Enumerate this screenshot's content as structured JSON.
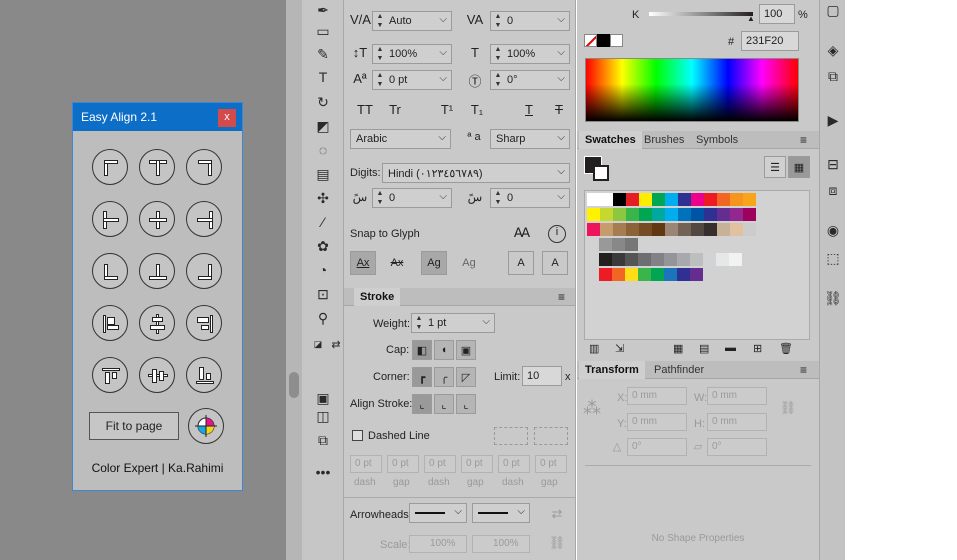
{
  "dialog": {
    "title": "Easy Align 2.1",
    "close_label": "x",
    "fit_label": "Fit to page",
    "credit": "Color Expert | Ka.Rahimi"
  },
  "character": {
    "kerning": "Auto",
    "tracking": "0",
    "vscale": "100%",
    "hscale": "100%",
    "baseline": "0 pt",
    "rotation": "0°",
    "glyph_tt1": "TT",
    "glyph_tt2": "Tr",
    "glyph_t3": "T¹",
    "glyph_t4": "T₁",
    "glyph_t5": "T",
    "glyph_t6": "T",
    "language": "Arabic",
    "aa_label": "ª a",
    "aa_method": "Sharp",
    "digits_label": "Digits:",
    "digits_value": "Hindi (٠١٢٣٤٥٦٧٨٩)",
    "kashida1": "0",
    "kashida2": "0",
    "snap_label": "Snap to Glyph",
    "snap_btns": [
      "Ax",
      "Ax",
      "Ag",
      "Ag",
      "A",
      "A"
    ]
  },
  "color": {
    "k_label": "K",
    "k_value": "100",
    "k_unit": "%",
    "hex_prefix": "#",
    "hex_value": "231F20"
  },
  "swatches": {
    "tabs": [
      "Swatches",
      "Brushes",
      "Symbols"
    ]
  },
  "stroke": {
    "title": "Stroke",
    "weight_label": "Weight:",
    "weight": "1 pt",
    "cap_label": "Cap:",
    "corner_label": "Corner:",
    "limit_label": "Limit:",
    "limit": "10",
    "limit_unit": "x",
    "align_label": "Align Stroke:",
    "dashed_label": "Dashed Line",
    "dash_values": [
      "0 pt",
      "0 pt",
      "0 pt",
      "0 pt",
      "0 pt",
      "0 pt"
    ],
    "dash_labels": [
      "dash",
      "gap",
      "dash",
      "gap",
      "dash",
      "gap"
    ],
    "arrowheads_label": "Arrowheads:",
    "scale_label": "Scale:",
    "scale1": "100%",
    "scale2": "100%"
  },
  "transform": {
    "tabs": [
      "Transform",
      "Pathfinder"
    ],
    "x_label": "X:",
    "x": "0 mm",
    "w_label": "W:",
    "w": "0 mm",
    "y_label": "Y:",
    "y": "0 mm",
    "h_label": "H:",
    "h": "0 mm",
    "angle": "0°",
    "shear": "0°",
    "no_shape": "No Shape Properties"
  }
}
